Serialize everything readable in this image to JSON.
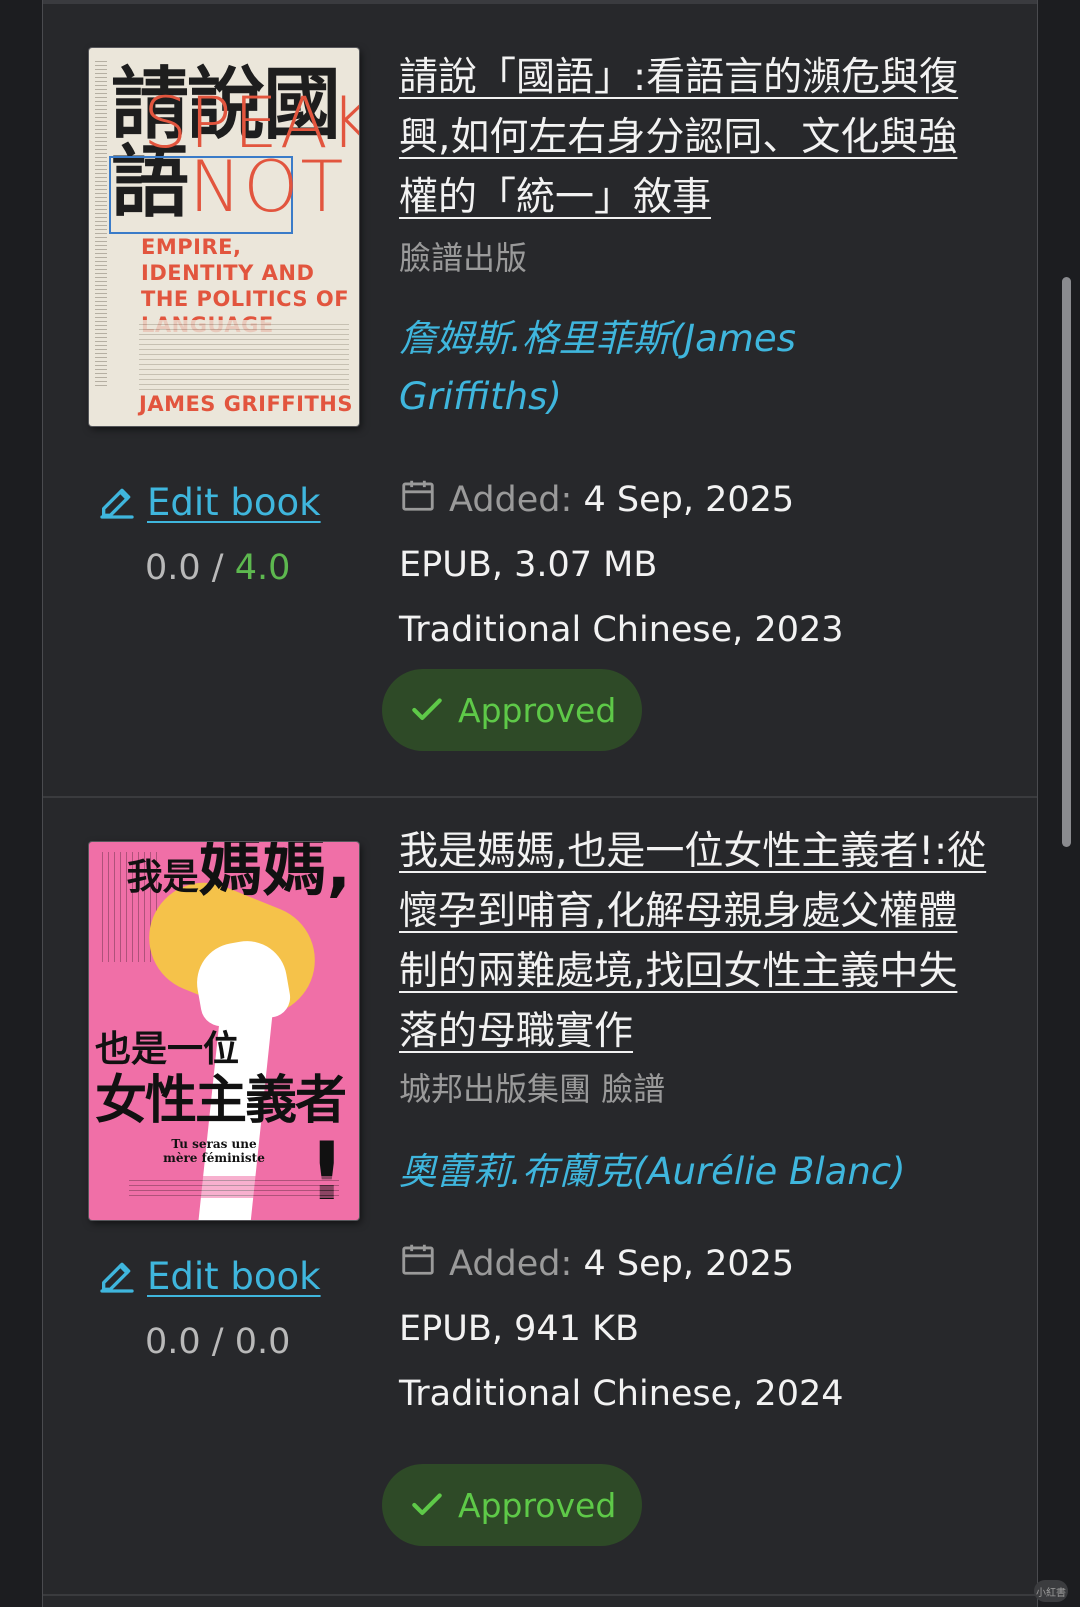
{
  "books": [
    {
      "title": "請說「國語」:看語言的瀕危與復興,如何左右身分認同、文化與強權的「統一」敘事",
      "publisher": "臉譜出版",
      "author": "詹姆斯.格里菲斯(James Griffiths)",
      "edit_label": "Edit book",
      "rating_value": "0.0",
      "rating_sep": " / ",
      "rating_max": "4.0",
      "added_label": "Added:",
      "added_date": "4 Sep, 2025",
      "format_size": "EPUB, 3.07 MB",
      "language_year": "Traditional Chinese, 2023",
      "status": "Approved",
      "cover": {
        "title_cn": "請說國語",
        "title_en_1": "SPEAK",
        "title_en_2": "NOT",
        "subtitle": "EMPIRE, IDENTITY AND THE POLITICS OF LANGUAGE",
        "author": "JAMES GRIFFITHS"
      }
    },
    {
      "title": "我是媽媽,也是一位女性主義者!:從懷孕到哺育,化解母親身處父權體制的兩難處境,找回女性主義中失落的母職實作",
      "publisher": "城邦出版集團 臉譜",
      "author": "奧蕾莉.布蘭克(Aurélie Blanc)",
      "edit_label": "Edit book",
      "rating_value": "0.0",
      "rating_sep": " / ",
      "rating_max": "0.0",
      "added_label": "Added:",
      "added_date": "4 Sep, 2025",
      "format_size": "EPUB, 941 KB",
      "language_year": "Traditional Chinese, 2024",
      "status": "Approved",
      "cover": {
        "line1": "我是",
        "line1_big": "媽媽,",
        "line2": "也是一位",
        "line3": "女性主義者",
        "bang": "!",
        "fr_title": "Tu seras une mère féministe"
      }
    }
  ],
  "corner_badge": "小紅書",
  "colors": {
    "background": "#1c1d20",
    "panel": "#27282b",
    "link": "#3fb6dd",
    "approved_bg": "#2e4a27",
    "approved_text": "#5ec948",
    "rating_green": "#5db84f"
  }
}
